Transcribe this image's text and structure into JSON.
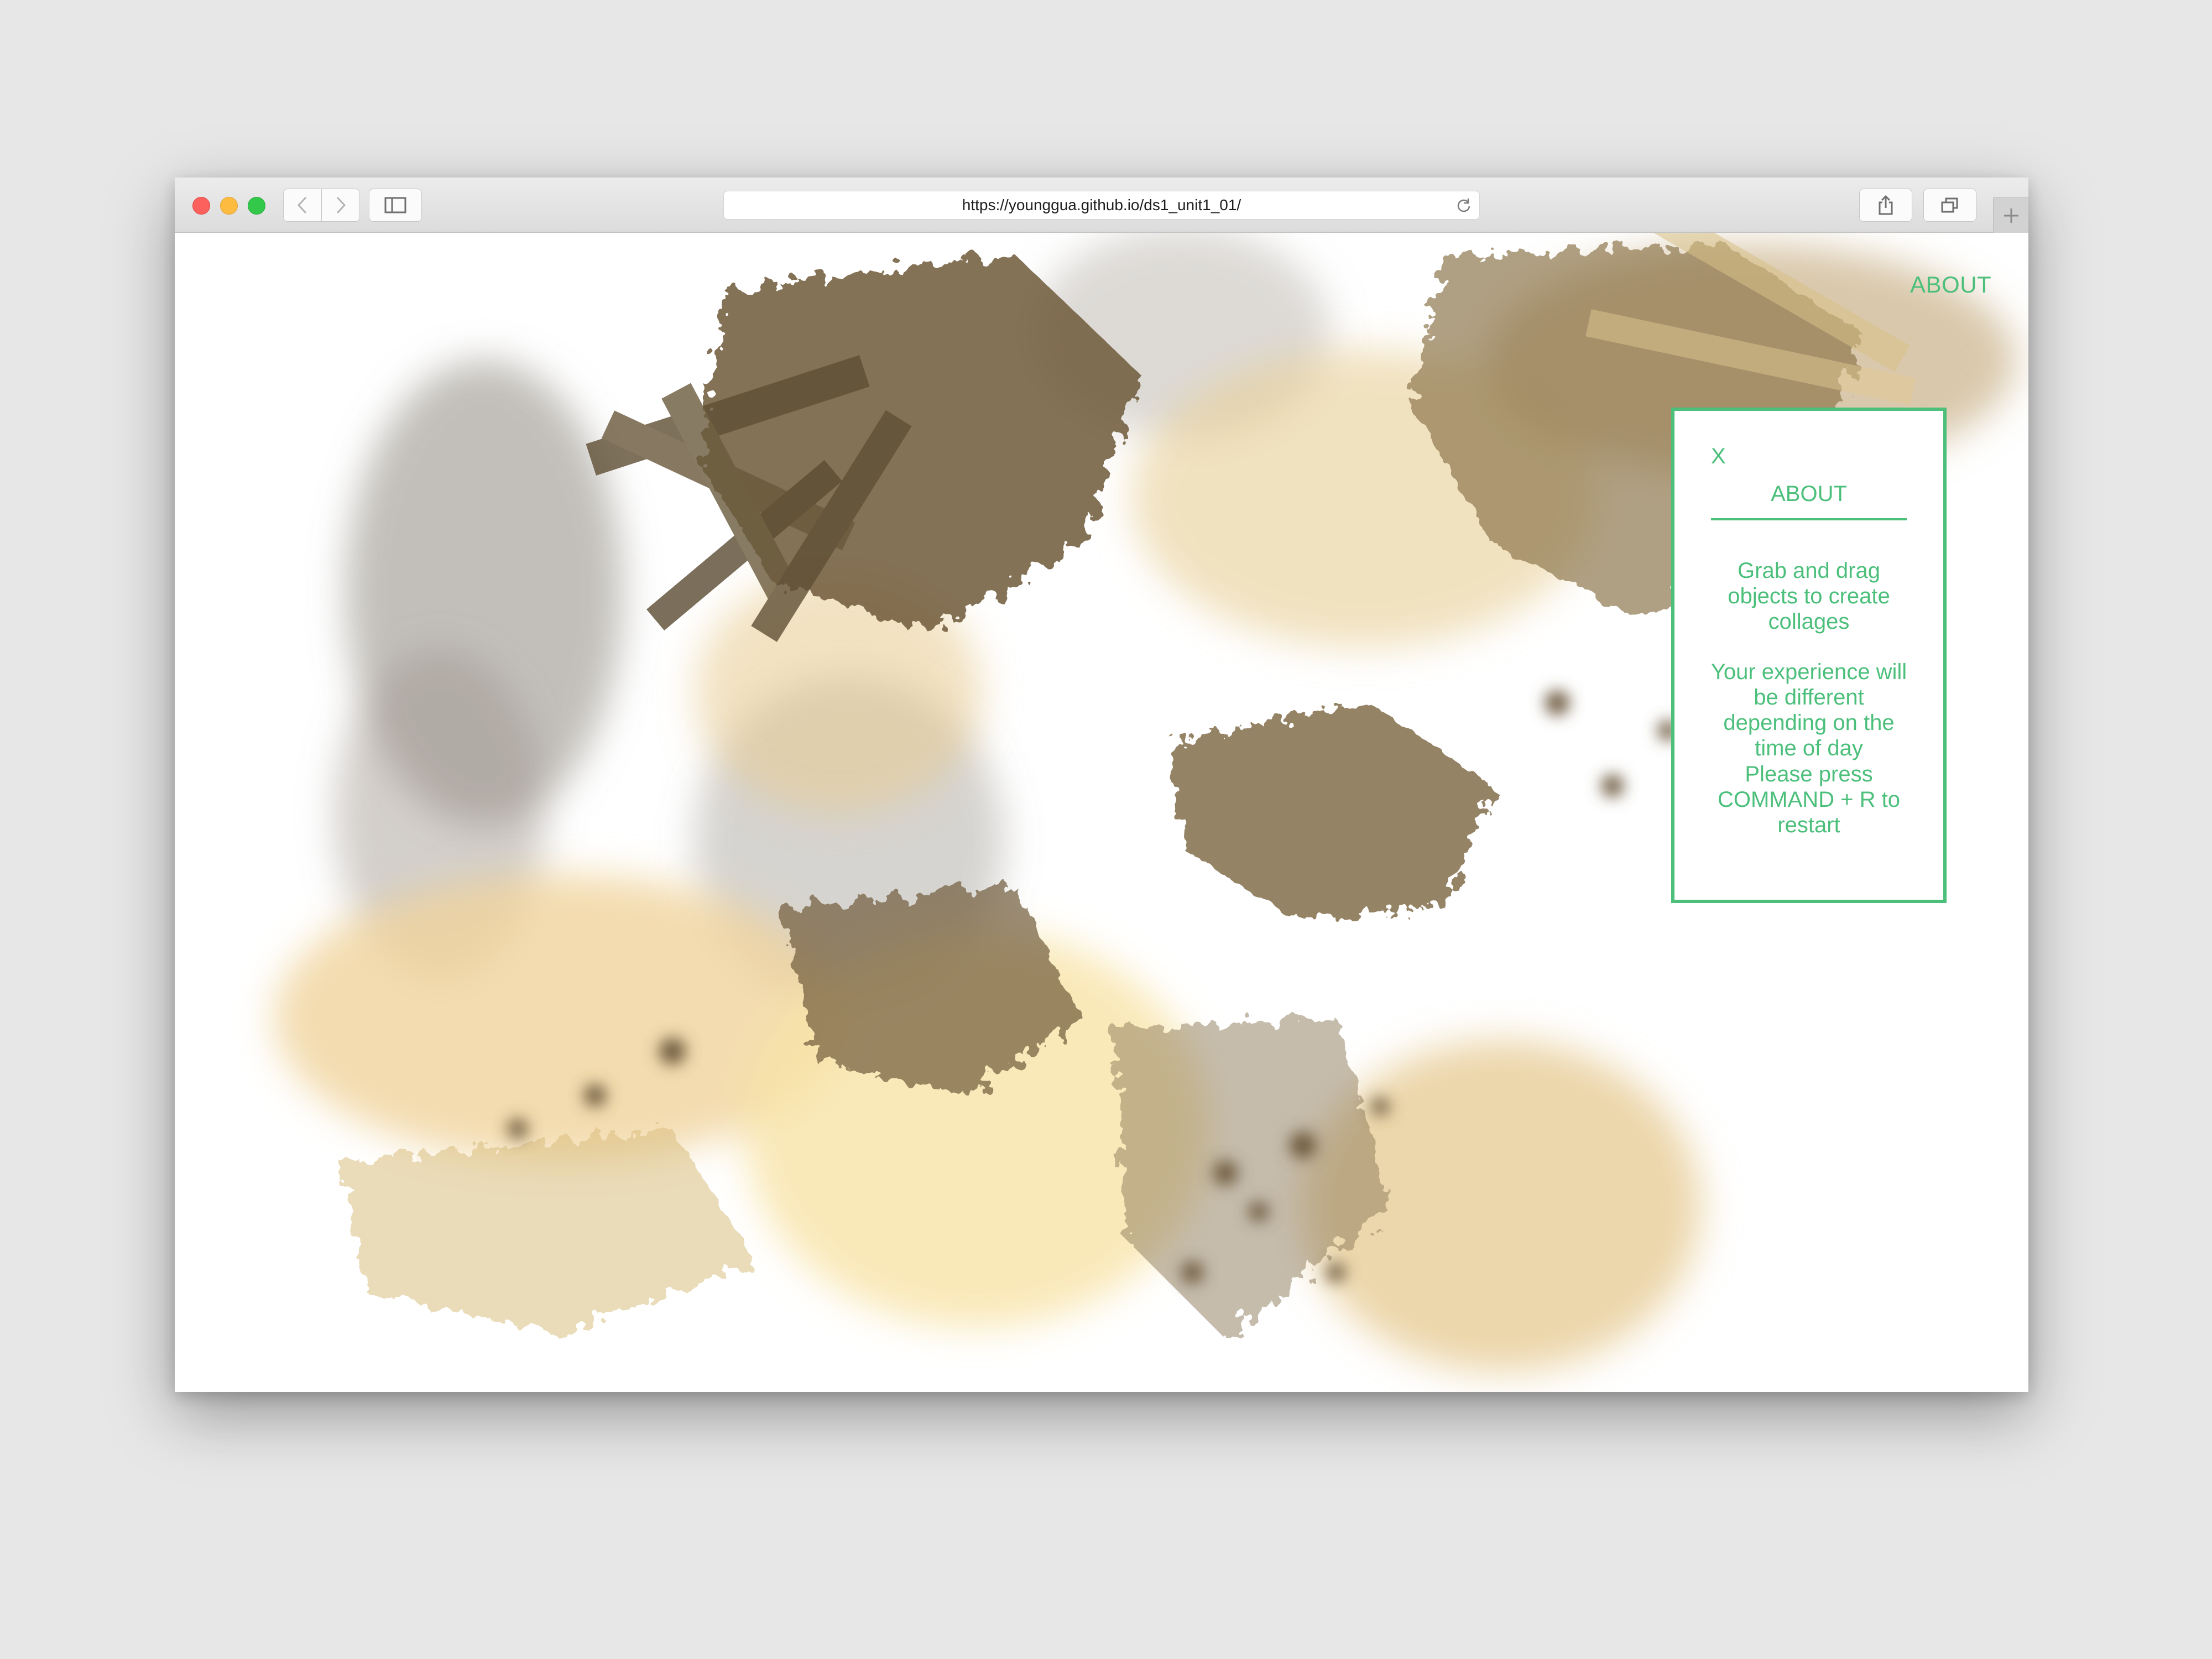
{
  "browser": {
    "url": "https://younggua.github.io/ds1_unit1_01/",
    "icons": {
      "back": "chevron-left-icon",
      "forward": "chevron-right-icon",
      "sidebar": "sidebar-icon",
      "reload": "reload-icon",
      "share": "share-icon",
      "tabs": "tabs-icon",
      "new_tab": "plus-icon"
    }
  },
  "page": {
    "nav_about": "ABOUT",
    "about_panel": {
      "close": "X",
      "title": "ABOUT",
      "paragraphs": [
        "Grab and drag objects to create collages",
        "Your experience will be different depending on the time of day",
        "Please press COMMAND + R to restart"
      ]
    },
    "accent_color": "#4cbf7b",
    "collage_colors": [
      "#6e5a3a",
      "#a68c5a",
      "#d9bd7f",
      "#f3d9a0",
      "#9d958b"
    ]
  }
}
